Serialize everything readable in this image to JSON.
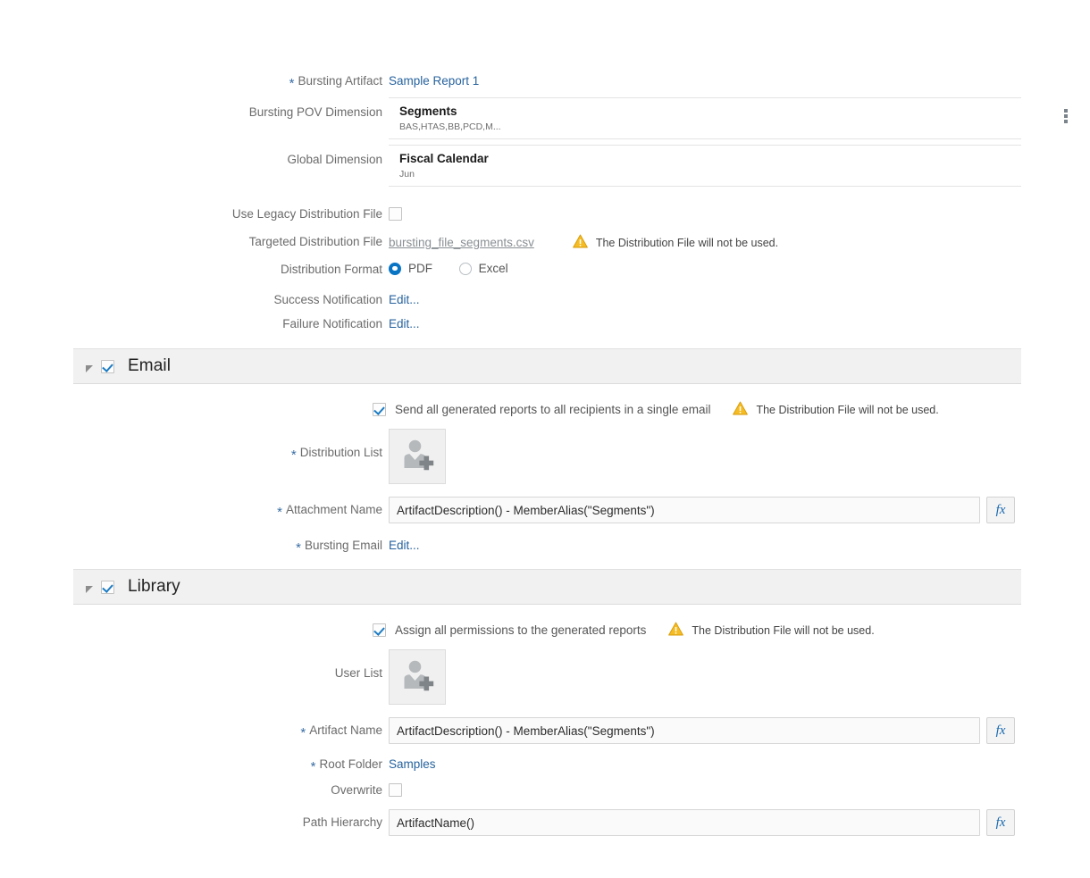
{
  "form": {
    "bursting_artifact": {
      "label": "Bursting Artifact",
      "value": "Sample Report 1",
      "required": true
    },
    "pov_dimension": {
      "label": "Bursting POV Dimension",
      "title": "Segments",
      "members": "BAS,HTAS,BB,PCD,M...",
      "menu_icon": "more-vertical-icon"
    },
    "global_dimension": {
      "label": "Global Dimension",
      "title": "Fiscal Calendar",
      "members": "Jun"
    },
    "use_legacy_distribution_file": {
      "label": "Use Legacy Distribution File",
      "checked": false
    },
    "targeted_distribution_file": {
      "label": "Targeted Distribution File",
      "value": "bursting_file_segments.csv"
    },
    "distribution_format": {
      "label": "Distribution Format",
      "options": [
        {
          "label": "PDF",
          "selected": true
        },
        {
          "label": "Excel",
          "selected": false
        }
      ]
    },
    "success_notification": {
      "label": "Success Notification",
      "action": "Edit..."
    },
    "failure_notification": {
      "label": "Failure Notification",
      "action": "Edit..."
    }
  },
  "warning": {
    "icon": "warning-triangle-icon",
    "text": "The Distribution File will not be used.",
    "color": "#f5bc23"
  },
  "email_section": {
    "title": "Email",
    "enabled": true,
    "expanded": true,
    "send_single_email": {
      "label": "Send all generated reports to all recipients in a single email",
      "checked": true
    },
    "distribution_list": {
      "label": "Distribution List",
      "required": true,
      "icon": "add-user-icon"
    },
    "attachment_name": {
      "label": "Attachment Name",
      "required": true,
      "value": "ArtifactDescription() - MemberAlias(\"Segments\")",
      "fx_label": "fx"
    },
    "bursting_email": {
      "label": "Bursting Email",
      "required": true,
      "action": "Edit..."
    }
  },
  "library_section": {
    "title": "Library",
    "enabled": true,
    "expanded": true,
    "assign_permissions": {
      "label": "Assign all permissions to the generated reports",
      "checked": true
    },
    "user_list": {
      "label": "User List",
      "required": false,
      "icon": "add-user-icon"
    },
    "artifact_name": {
      "label": "Artifact Name",
      "required": true,
      "value": "ArtifactDescription() - MemberAlias(\"Segments\")",
      "fx_label": "fx"
    },
    "root_folder": {
      "label": "Root Folder",
      "required": true,
      "value": "Samples"
    },
    "overwrite": {
      "label": "Overwrite",
      "checked": false
    },
    "path_hierarchy": {
      "label": "Path Hierarchy",
      "required": false,
      "value": "ArtifactName()",
      "fx_label": "fx"
    }
  }
}
